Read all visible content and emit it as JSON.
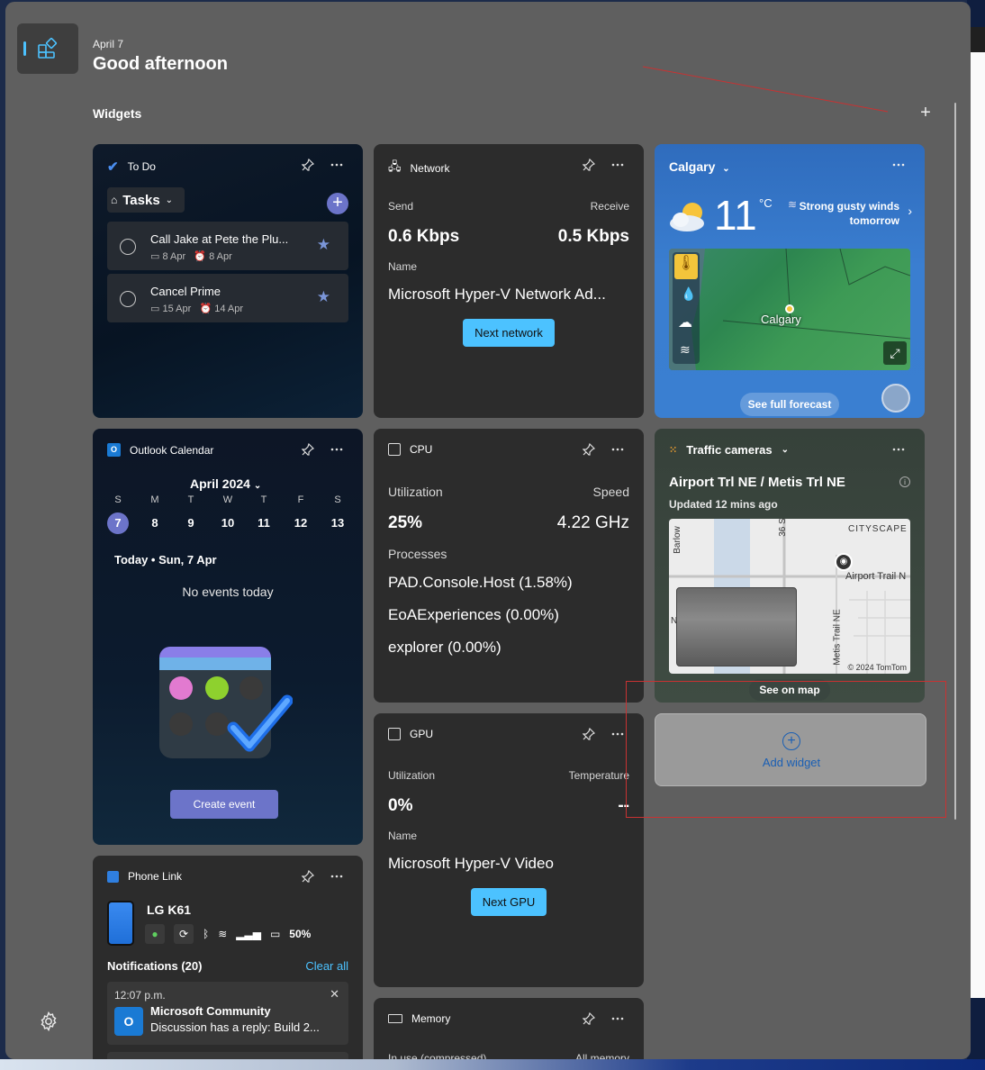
{
  "header": {
    "date": "April 7",
    "greeting": "Good afternoon",
    "section_label": "Widgets"
  },
  "todo": {
    "title": "To Do",
    "list_name": "Tasks",
    "tasks": [
      {
        "name": "Call Jake at Pete the Plu...",
        "due": "8 Apr",
        "reminder": "8 Apr"
      },
      {
        "name": "Cancel Prime",
        "due": "15 Apr",
        "reminder": "14 Apr"
      }
    ]
  },
  "network": {
    "title": "Network",
    "send_label": "Send",
    "receive_label": "Receive",
    "send_value": "0.6 Kbps",
    "receive_value": "0.5 Kbps",
    "name_label": "Name",
    "name_value": "Microsoft Hyper-V Network Ad...",
    "button": "Next network"
  },
  "weather": {
    "city": "Calgary",
    "temp": "11",
    "unit": "°C",
    "condition_line1": "Strong gusty winds",
    "condition_line2": "tomorrow",
    "map_city_label": "Calgary",
    "forecast_button": "See full forecast"
  },
  "calendar": {
    "title": "Outlook Calendar",
    "month": "April 2024",
    "weekdays": [
      "S",
      "M",
      "T",
      "W",
      "T",
      "F",
      "S"
    ],
    "days": [
      "7",
      "8",
      "9",
      "10",
      "11",
      "12",
      "13"
    ],
    "today_line": "Today • Sun, 7 Apr",
    "empty": "No events today",
    "button": "Create event"
  },
  "cpu": {
    "title": "CPU",
    "util_label": "Utilization",
    "speed_label": "Speed",
    "util_value": "25%",
    "speed_value": "4.22 GHz",
    "processes_label": "Processes",
    "processes": [
      "PAD.Console.Host (1.58%)",
      "EoAExperiences (0.00%)",
      "explorer (0.00%)"
    ]
  },
  "traffic": {
    "title": "Traffic cameras",
    "location": "Airport Trl NE / Metis Trl NE",
    "updated": "Updated 12 mins ago",
    "map_labels": {
      "cityscape": "CITYSCAPE",
      "barlow": "Barlow",
      "s36": "36 S",
      "airport": "Airport Trail N",
      "metis": "Metis Trail NE",
      "copyright": "© 2024 TomTom",
      "n": "N"
    },
    "button": "See on map"
  },
  "gpu": {
    "title": "GPU",
    "util_label": "Utilization",
    "temp_label": "Temperature",
    "util_value": "0%",
    "temp_value": "--",
    "name_label": "Name",
    "name_value": "Microsoft Hyper-V Video",
    "button": "Next GPU"
  },
  "add_widget": {
    "label": "Add widget"
  },
  "phone": {
    "title": "Phone Link",
    "device": "LG K61",
    "battery": "50%",
    "notif_label": "Notifications (20)",
    "clear": "Clear all",
    "notification": {
      "time": "12:07 p.m.",
      "app": "Microsoft Community",
      "text": "Discussion has a reply: Build 2..."
    }
  },
  "memory": {
    "title": "Memory",
    "left_label": "In use (compressed)",
    "right_label": "All memory"
  },
  "colors": {
    "accent": "#4cc2ff",
    "panel": "#5f5f5f",
    "card": "#2c2c2c",
    "calendar_accent": "#6c74c9"
  }
}
